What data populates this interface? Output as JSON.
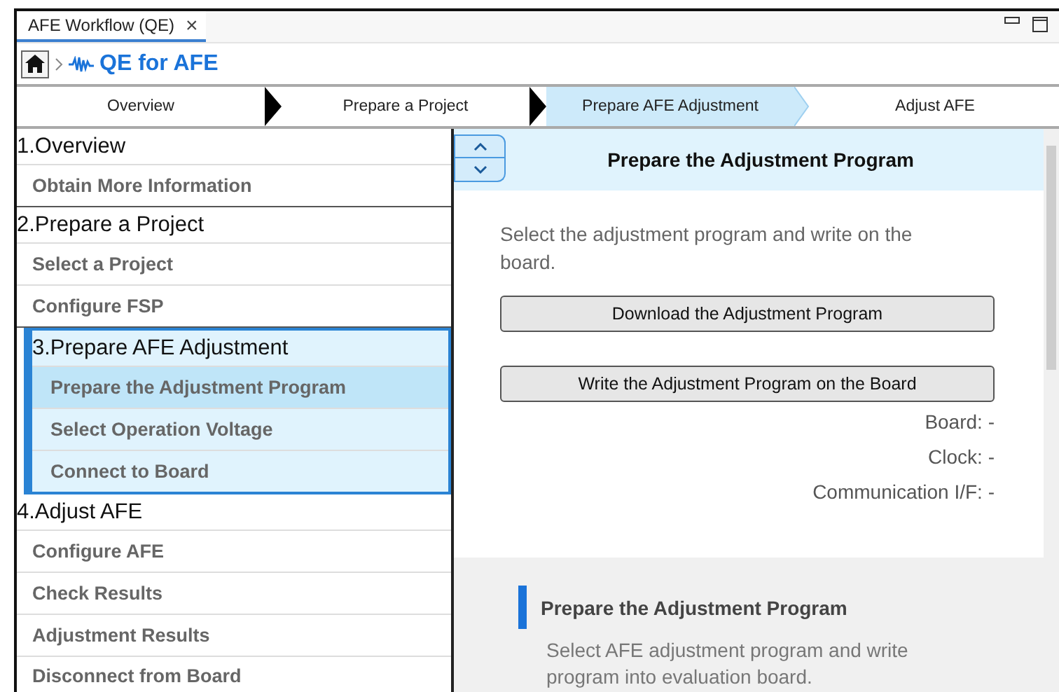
{
  "window": {
    "tab_title": "AFE Workflow (QE)",
    "close": "×"
  },
  "breadcrumb": {
    "title": "QE for AFE"
  },
  "steps": [
    {
      "label": "Overview",
      "selected": false
    },
    {
      "label": "Prepare a Project",
      "selected": false
    },
    {
      "label": "Prepare AFE Adjustment",
      "selected": true
    },
    {
      "label": "Adjust AFE",
      "selected": false
    }
  ],
  "menu": [
    {
      "title": "1.Overview",
      "selected": false,
      "children": [
        {
          "label": "Obtain More Information",
          "selected": false
        }
      ]
    },
    {
      "title": "2.Prepare a Project",
      "selected": false,
      "children": [
        {
          "label": "Select a Project",
          "selected": false
        },
        {
          "label": "Configure FSP",
          "selected": false
        }
      ]
    },
    {
      "title": "3.Prepare AFE Adjustment",
      "selected": true,
      "children": [
        {
          "label": "Prepare the Adjustment Program",
          "selected": true
        },
        {
          "label": "Select Operation Voltage",
          "selected": false
        },
        {
          "label": "Connect to Board",
          "selected": false
        }
      ]
    },
    {
      "title": "4.Adjust AFE",
      "selected": false,
      "children": [
        {
          "label": "Configure AFE",
          "selected": false
        },
        {
          "label": "Check Results",
          "selected": false
        },
        {
          "label": "Adjustment Results",
          "selected": false
        },
        {
          "label": "Disconnect from Board",
          "selected": false
        }
      ]
    }
  ],
  "panel": {
    "title": "Prepare the Adjustment Program",
    "description": "Select the adjustment program and write on the board.",
    "buttons": [
      "Download the Adjustment Program",
      "Write the Adjustment Program on the Board"
    ],
    "info": [
      "Board: -",
      "Clock: -",
      "Communication I/F: -"
    ]
  },
  "help": {
    "heading": "Prepare the Adjustment Program",
    "text": "Select AFE adjustment program and write program into evaluation board."
  }
}
